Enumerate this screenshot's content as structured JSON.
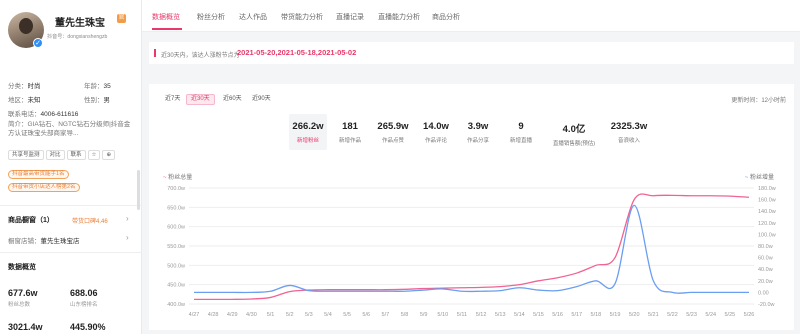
{
  "profile": {
    "name": "董先生珠宝",
    "badge": "官",
    "subtitle": "抖音号：dongxianshengzb",
    "category_label": "分类：",
    "category": "时尚",
    "age_label": "年龄：",
    "age": "35",
    "region_label": "地区：",
    "region": "未知",
    "gender_label": "性别：",
    "gender": "男",
    "contact_label": "联系电话：",
    "contact": "4006-611616",
    "intro": "简介：GIA钻石、NGTC钻石分级师|抖音金方认证珠宝头部商家导...",
    "buttons": [
      "共享号监测",
      "对比",
      "联系",
      "☆",
      "⊕"
    ],
    "tags": [
      "抖音最高带货能手1名",
      "抖音带货小店达人榜第2名"
    ],
    "shop_section_title": "商品橱窗（1）",
    "shop_section_link": "带货口碑4.46",
    "shop_store_label": "橱窗店铺：",
    "shop_store_value": "董先生珠宝店",
    "overview_title": "数据概览",
    "stats": [
      {
        "value": "677.6w",
        "label": "粉丝总数"
      },
      {
        "value": "688.06",
        "label": "山东榜排名"
      },
      {
        "value": "3021.4w",
        "label": ""
      },
      {
        "value": "445.90%",
        "label": ""
      }
    ]
  },
  "tabs": [
    "数据概览",
    "粉丝分析",
    "达人作品",
    "带货能力分析",
    "直播记录",
    "直播能力分析",
    "商品分析"
  ],
  "active_tab": 0,
  "alert": {
    "text": "近30天内，该达人涨粉节点为",
    "dates": "2021-05-20,2021-05-18,2021-05-02"
  },
  "ranges": [
    "近7天",
    "近30天",
    "近60天",
    "近90天"
  ],
  "active_range": 1,
  "updated": "更新时间：12小时前",
  "metrics": [
    {
      "value": "266.2w",
      "label": "新增粉丝"
    },
    {
      "value": "181",
      "label": "新增作品"
    },
    {
      "value": "265.9w",
      "label": "作品点赞"
    },
    {
      "value": "14.0w",
      "label": "作品评论"
    },
    {
      "value": "3.9w",
      "label": "作品分享"
    },
    {
      "value": "9",
      "label": "新增直播"
    },
    {
      "value": "4.0亿",
      "label": "直播销售额(预估)"
    },
    {
      "value": "2325.3w",
      "label": "音浪收入"
    }
  ],
  "active_metric": 0,
  "legend_left": "粉丝总量",
  "legend_right": "粉丝增量",
  "colors": {
    "accent": "#e8396a",
    "pink_line": "#f06392",
    "blue_line": "#6a9ef0"
  },
  "chart_data": {
    "type": "line",
    "x": [
      "4/27",
      "4/28",
      "4/29",
      "4/30",
      "5/1",
      "5/2",
      "5/3",
      "5/4",
      "5/5",
      "5/6",
      "5/7",
      "5/8",
      "5/9",
      "5/10",
      "5/11",
      "5/12",
      "5/13",
      "5/14",
      "5/15",
      "5/16",
      "5/17",
      "5/18",
      "5/19",
      "5/20",
      "5/21",
      "5/22",
      "5/23",
      "5/24",
      "5/25",
      "5/26"
    ],
    "left_axis": {
      "ticks": [
        "400.0w",
        "450.0w",
        "500.0w",
        "550.0w",
        "600.0w",
        "650.0w",
        "700.0w"
      ],
      "range": [
        400,
        700
      ]
    },
    "right_axis": {
      "ticks": [
        "-20.0w",
        "0.00",
        "20.0w",
        "40.0w",
        "60.0w",
        "80.0w",
        "100.0w",
        "120.0w",
        "140.0w",
        "160.0w",
        "180.0w"
      ],
      "range": [
        -20,
        180
      ]
    },
    "series": [
      {
        "name": "粉丝总量",
        "axis": "left",
        "values": [
          412,
          412,
          412,
          413,
          417,
          432,
          436,
          437,
          437,
          437,
          437,
          438,
          440,
          441,
          442,
          443,
          445,
          450,
          460,
          468,
          480,
          500,
          520,
          670,
          680,
          681,
          680,
          680,
          679,
          676
        ]
      },
      {
        "name": "粉丝增量",
        "axis": "right",
        "values": [
          0,
          0,
          0,
          0,
          2,
          12,
          3,
          2,
          2,
          2,
          2,
          2,
          4,
          6,
          2,
          2,
          3,
          8,
          4,
          3,
          10,
          20,
          15,
          150,
          20,
          0,
          0,
          0,
          0,
          0
        ]
      }
    ]
  }
}
